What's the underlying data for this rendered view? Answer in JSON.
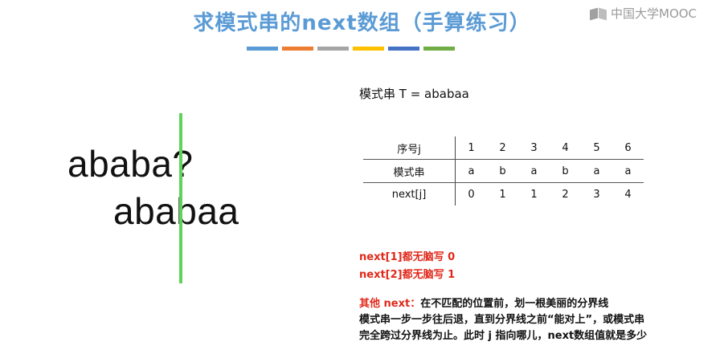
{
  "title": "求模式串的next数组（手算练习）",
  "title_color": "#5b9bd5",
  "color_bar": [
    "#5b9bd5",
    "#ed7d31",
    "#a5a5a5",
    "#ffc000",
    "#4472c4",
    "#70ad47"
  ],
  "logo": {
    "text": "中国大学MOOC",
    "icon": "mooc-book-icon"
  },
  "main_text": "ababa?",
  "pattern_text": "ababaa",
  "divider_color": "#5fd35a",
  "pattern_label": "模式串 T = ababaa",
  "table": {
    "headers": [
      "序号j",
      "模式串",
      "next[j]"
    ],
    "j": [
      "1",
      "2",
      "3",
      "4",
      "5",
      "6"
    ],
    "pattern": [
      "a",
      "b",
      "a",
      "b",
      "a",
      "a"
    ],
    "next": [
      "0",
      "1",
      "1",
      "2",
      "3",
      "4"
    ]
  },
  "rules": [
    "next[1]都无脑写 0",
    "next[2]都无脑写 1"
  ],
  "explanation": {
    "label": "其他 next：",
    "line1": "在不匹配的位置前，划一根美丽的分界线",
    "line2": "模式串一步一步往后退，直到分界线之前“能对上”，或模式串",
    "line3": "完全跨过分界线为止。此时 j 指向哪儿，next数组值就是多少"
  }
}
